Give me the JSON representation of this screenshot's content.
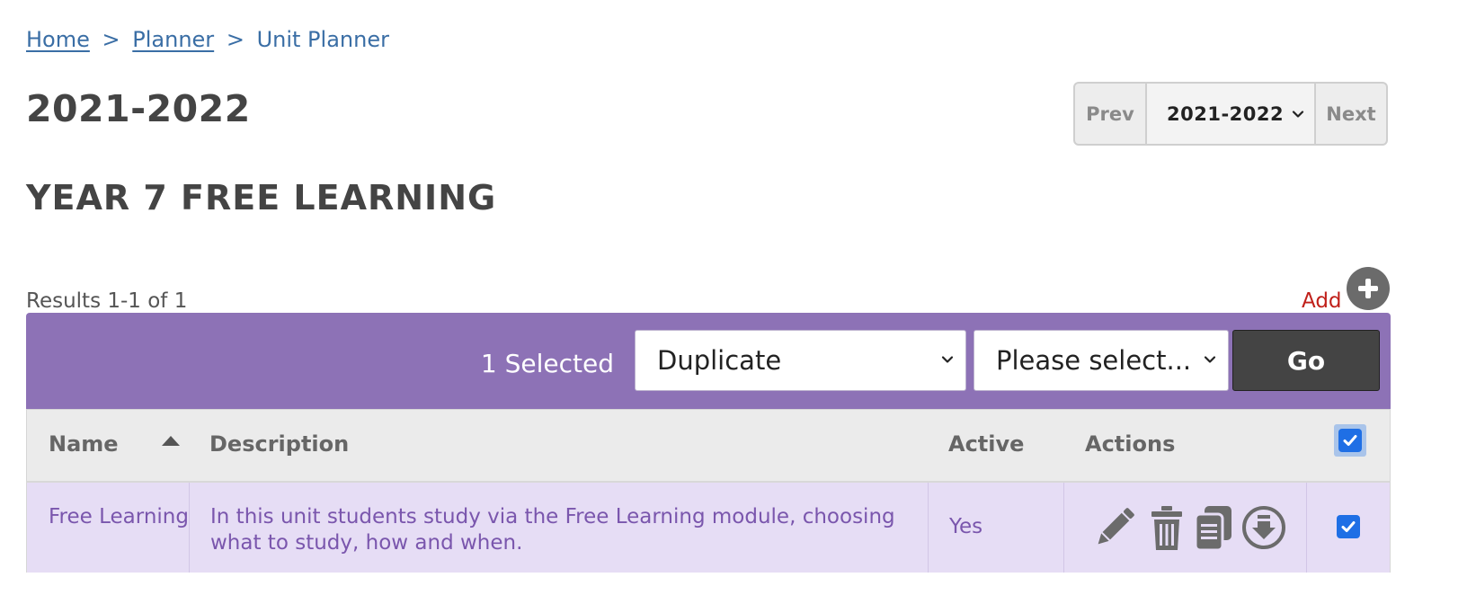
{
  "breadcrumb": {
    "items": [
      {
        "label": "Home"
      },
      {
        "label": "Planner"
      },
      {
        "label": "Unit Planner"
      }
    ],
    "separator": ">"
  },
  "page_title": "2021-2022",
  "year_nav": {
    "prev_label": "Prev",
    "selected_year": "2021-2022",
    "next_label": "Next"
  },
  "section_title": "YEAR 7 FREE LEARNING",
  "results_text": "Results 1-1 of 1",
  "add_label": "Add",
  "bulk_actions": {
    "selected_count": "1 Selected",
    "action_value": "Duplicate",
    "target_value": "Please select...",
    "go_label": "Go"
  },
  "table": {
    "columns": [
      "Name",
      "Description",
      "Active",
      "Actions"
    ],
    "sort": {
      "column": "Name",
      "direction": "ascending"
    },
    "select_all_checked": true,
    "rows": [
      {
        "name": "Free Learning",
        "description": "In this unit students study via the Free Learning module, choosing what to study, how and when.",
        "active": "Yes",
        "actions": [
          "pencil-icon",
          "trash-icon",
          "copy-icon",
          "download-icon"
        ],
        "checked": true
      }
    ]
  },
  "colors": {
    "link": "#3a6ea5",
    "add_link": "#c0201a",
    "bulk_bar": "#8d72b6",
    "row_highlight": "#e6ddf5",
    "row_text": "#7a56ad",
    "checkbox": "#1f6fe5",
    "go_button": "#444444"
  }
}
